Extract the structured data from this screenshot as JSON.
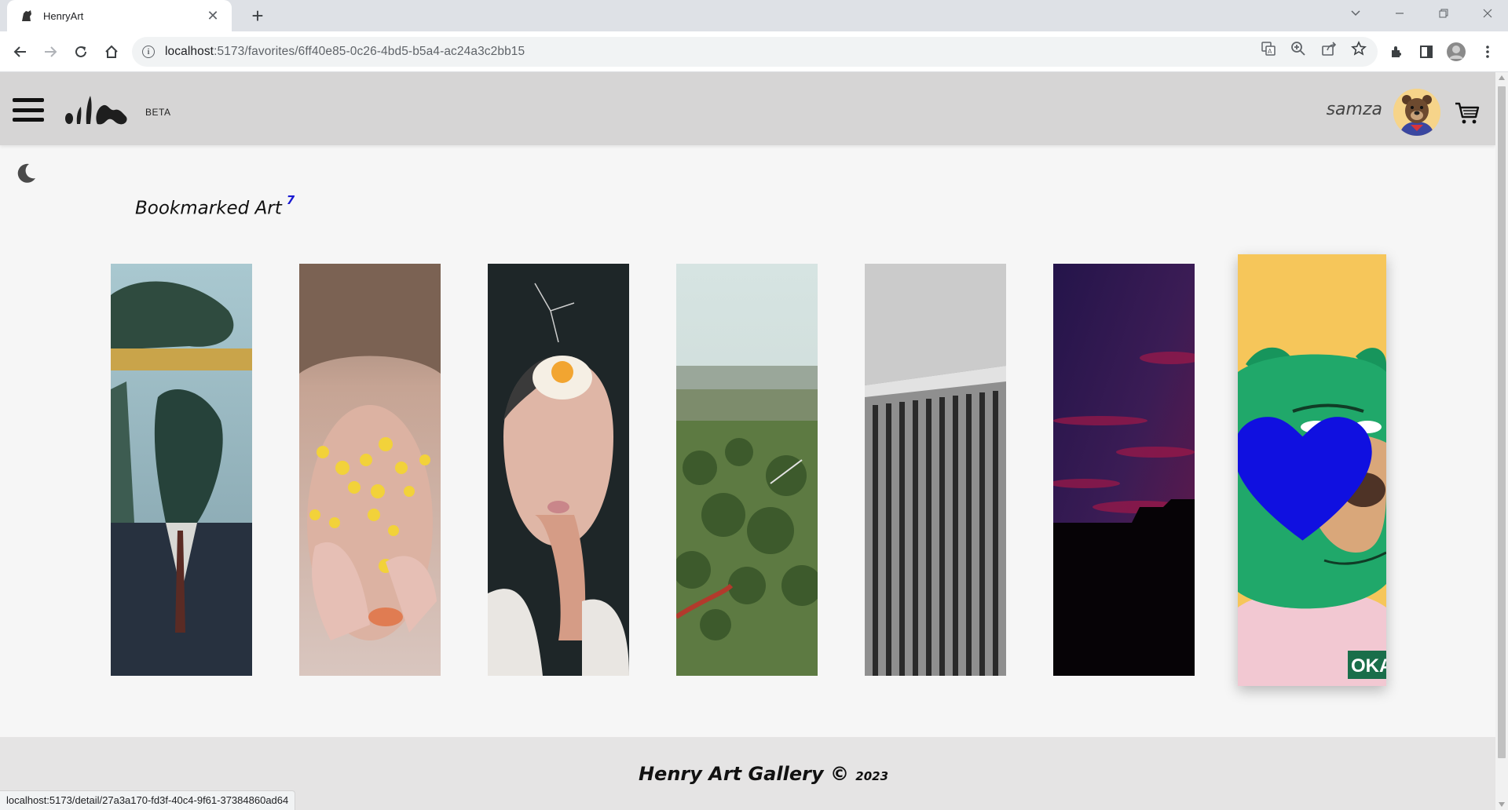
{
  "browser": {
    "tab_title": "HenryArt",
    "url_host": "localhost",
    "url_path": ":5173/favorites/6ff40e85-0c26-4bd5-b5a4-ac24a3c2bb15",
    "status_url": "localhost:5173/detail/27a3a170-fd3f-40c4-9f61-37384860ad64"
  },
  "header": {
    "beta_label": "BETA",
    "username": "samza"
  },
  "page": {
    "title": "Bookmarked Art",
    "count": "7"
  },
  "artworks": [
    {
      "name": "art-dragon-suit",
      "palette": [
        "#8fb4bf",
        "#2e4a3e",
        "#1d2a33"
      ]
    },
    {
      "name": "art-smiley-face",
      "palette": [
        "#b79a86",
        "#e0c0b0",
        "#f2d23a"
      ]
    },
    {
      "name": "art-egg-portrait",
      "palette": [
        "#1e2628",
        "#e4c2b4",
        "#f2a531"
      ]
    },
    {
      "name": "art-aerial-landscape",
      "palette": [
        "#d4e0de",
        "#5e7a44",
        "#35502c"
      ]
    },
    {
      "name": "art-concrete-building",
      "palette": [
        "#c9c9c9",
        "#6e6e6e",
        "#2b2b2b"
      ]
    },
    {
      "name": "art-purple-sky",
      "palette": [
        "#2a1748",
        "#7a1640",
        "#050205"
      ]
    },
    {
      "name": "art-green-bear",
      "palette": [
        "#f6c65a",
        "#20a86a",
        "#f2c8d2"
      ],
      "favorited": true
    }
  ],
  "footer": {
    "text": "Henry Art Gallery ©",
    "year": "2023"
  },
  "colors": {
    "header_bg": "#d6d5d5",
    "page_bg": "#f6f6f6",
    "accent_blue": "#1a1ad1",
    "heart": "#1010e0"
  }
}
